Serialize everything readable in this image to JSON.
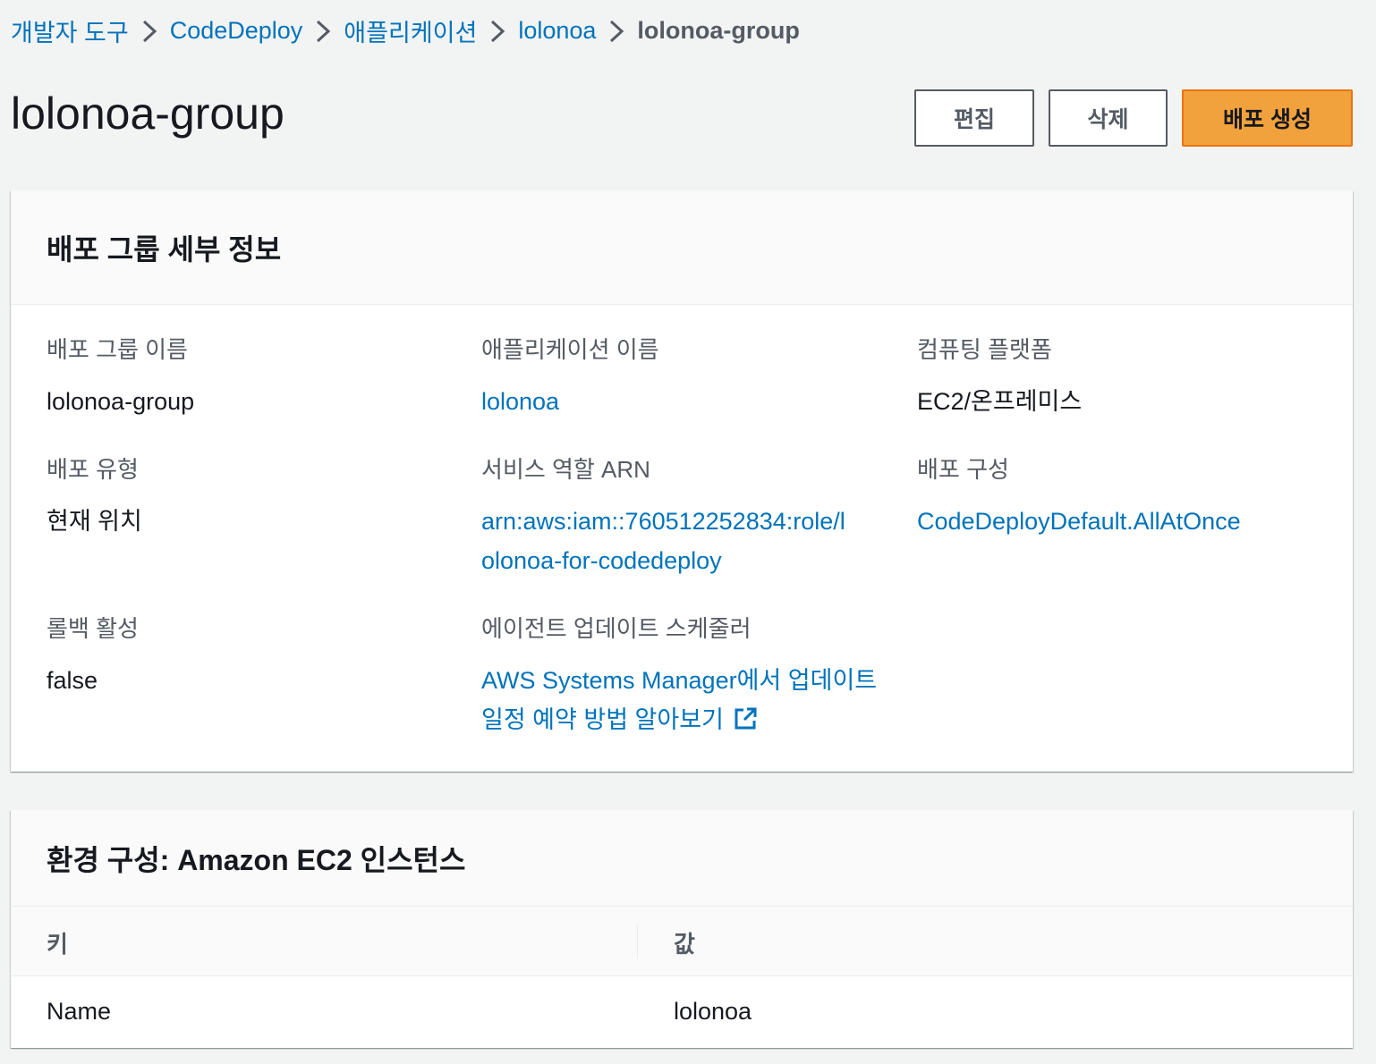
{
  "breadcrumb": {
    "items": [
      "개발자 도구",
      "CodeDeploy",
      "애플리케이션",
      "lolonoa"
    ],
    "current": "lolonoa-group"
  },
  "header": {
    "title": "lolonoa-group",
    "edit_label": "편집",
    "delete_label": "삭제",
    "create_label": "배포 생성"
  },
  "details": {
    "title": "배포 그룹 세부 정보",
    "fields": {
      "group_name": {
        "label": "배포 그룹 이름",
        "value": "lolonoa-group"
      },
      "app_name": {
        "label": "애플리케이션 이름",
        "value": "lolonoa"
      },
      "platform": {
        "label": "컴퓨팅 플랫폼",
        "value": "EC2/온프레미스"
      },
      "deploy_type": {
        "label": "배포 유형",
        "value": "현재 위치"
      },
      "role_arn": {
        "label": "서비스 역할 ARN",
        "value_line1": "arn:aws:iam::760512252834:role/l",
        "value_line2": "olonoa-for-codedeploy"
      },
      "deploy_config": {
        "label": "배포 구성",
        "value": "CodeDeployDefault.AllAtOnce"
      },
      "rollback": {
        "label": "롤백 활성",
        "value": "false"
      },
      "agent_scheduler": {
        "label": "에이전트 업데이트 스케줄러",
        "value_line1": "AWS Systems Manager에서 업데이트",
        "value_line2": "일정 예약 방법 알아보기"
      }
    }
  },
  "env": {
    "title": "환경 구성: Amazon EC2 인스턴스",
    "columns": [
      "키",
      "값"
    ],
    "rows": [
      {
        "key": "Name",
        "value": "lolonoa"
      }
    ]
  },
  "colors": {
    "link": "#0073bb",
    "primary": "#f2a23c"
  },
  "icons": {
    "separator": "chevron-right-icon",
    "external": "external-link-icon"
  }
}
